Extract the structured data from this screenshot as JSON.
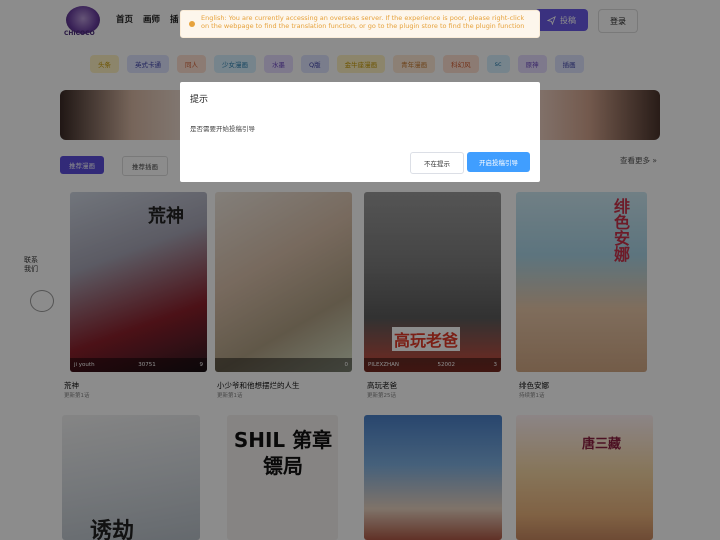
{
  "header": {
    "logo_text": "CHICOCO",
    "nav": [
      "首页",
      "画师",
      "插"
    ],
    "post_label": "投稿",
    "login_label": "登录"
  },
  "tags": [
    {
      "label": "头条",
      "bg": "#fff3c4",
      "color": "#c79a00"
    },
    {
      "label": "英式卡通",
      "bg": "#dfe3ff",
      "color": "#3a3fa8"
    },
    {
      "label": "同人",
      "bg": "#ffe0d2",
      "color": "#d25b2e"
    },
    {
      "label": "少女漫画",
      "bg": "#d8f1ff",
      "color": "#2a7fb0"
    },
    {
      "label": "水墨",
      "bg": "#e6ddff",
      "color": "#6b46c1"
    },
    {
      "label": "Q版",
      "bg": "#dfe3ff",
      "color": "#3a3fa8"
    },
    {
      "label": "金牛座漫画",
      "bg": "#fff3c4",
      "color": "#c79a00"
    },
    {
      "label": "青年漫画",
      "bg": "#ffe9d6",
      "color": "#c77a2e"
    },
    {
      "label": "科幻风",
      "bg": "#ffe0d2",
      "color": "#d25b2e"
    },
    {
      "label": "sc",
      "bg": "#d8f1ff",
      "color": "#2a7fb0"
    },
    {
      "label": "原神",
      "bg": "#e6ddff",
      "color": "#6b46c1"
    },
    {
      "label": "插画",
      "bg": "#dfe3ff",
      "color": "#3a3fa8"
    }
  ],
  "tabs": {
    "active": "推荐漫画",
    "inactive": "推荐插画",
    "more": "查看更多"
  },
  "side_link": "联系我们",
  "comics": [
    {
      "title": "荒神",
      "sub": "更新第1话",
      "cover_text": "荒神",
      "author": "ji youth",
      "views": "30751",
      "likes": "9"
    },
    {
      "title": "小少爷和他想摆烂的人生",
      "sub": "更新第1话",
      "cover_text": "",
      "author": "",
      "views": "",
      "likes": "0"
    },
    {
      "title": "高玩老爸",
      "sub": "更新第25话",
      "cover_text": "高玩老爸",
      "author": "PILEXZHAN",
      "views": "52002",
      "likes": "3"
    },
    {
      "title": "绯色安娜",
      "sub": "持续第1话",
      "cover_text": "绯色安娜",
      "author": "",
      "views": "",
      "likes": ""
    },
    {
      "title": "",
      "sub": "",
      "cover_text": "诱劫",
      "author": "",
      "views": "",
      "likes": ""
    },
    {
      "title": "",
      "sub": "",
      "cover_text": "SHIL 第章镖局",
      "author": "",
      "views": "",
      "likes": ""
    },
    {
      "title": "",
      "sub": "",
      "cover_text": "",
      "author": "",
      "views": "",
      "likes": ""
    },
    {
      "title": "",
      "sub": "",
      "cover_text": "唐三藏",
      "author": "",
      "views": "",
      "likes": ""
    }
  ],
  "toast": {
    "message": "English: You are currently accessing an overseas server. If the experience is poor, please right-click on the webpage to find the translation function, or go to the plugin store to find the plugin function"
  },
  "dialog": {
    "title": "提示",
    "body": "是否需要开始投稿引导",
    "cancel_label": "不在提示",
    "confirm_label": "开启投稿引导"
  }
}
